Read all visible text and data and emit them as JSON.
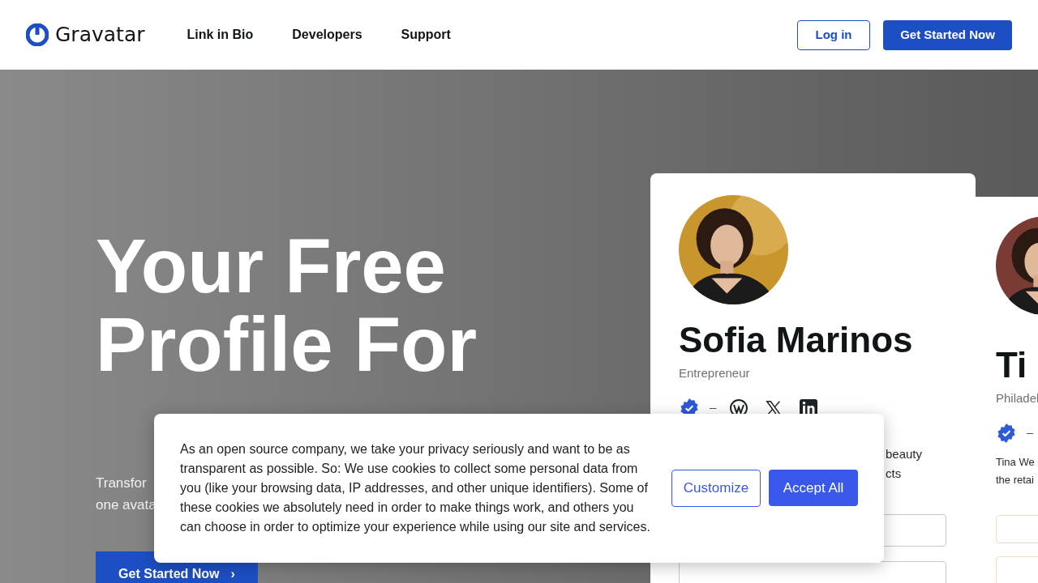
{
  "header": {
    "logo": "Gravatar",
    "nav": [
      {
        "label": "Link in Bio"
      },
      {
        "label": "Developers"
      },
      {
        "label": "Support"
      }
    ],
    "login": "Log in",
    "cta": "Get Started Now"
  },
  "hero": {
    "headline": [
      "Your Free",
      "Profile For"
    ],
    "subtitle": [
      "Transfor",
      "one avata"
    ],
    "cta": "Get Started Now",
    "cta_icon": "›"
  },
  "cards": [
    {
      "name": "Sofia Marinos",
      "tagline": "Entrepreneur",
      "separator": "–",
      "socials": [
        {
          "kind": "verified"
        },
        {
          "kind": "wordpress"
        },
        {
          "kind": "x"
        },
        {
          "kind": "linkedin"
        }
      ],
      "bio": [
        "beauty",
        "cts"
      ]
    },
    {
      "name": "Ti",
      "tagline": "Philadel",
      "separator": "–",
      "socials": [
        {
          "kind": "verified"
        }
      ],
      "bio": [
        "Tina We",
        "the retai"
      ]
    }
  ],
  "cookie": {
    "text": "As an open source company, we take your privacy seriously and want to be as transparent as possible. So: We use cookies to collect some personal data from you (like your browsing data, IP addresses, and other unique identifiers). Some of these cookies we absolutely need in order to make things work, and others you can choose in order to optimize your experience while using our site and services.",
    "buttons": [
      {
        "label": "Customize",
        "kind": "secondary"
      },
      {
        "label": "Accept All",
        "kind": "primary"
      }
    ]
  }
}
